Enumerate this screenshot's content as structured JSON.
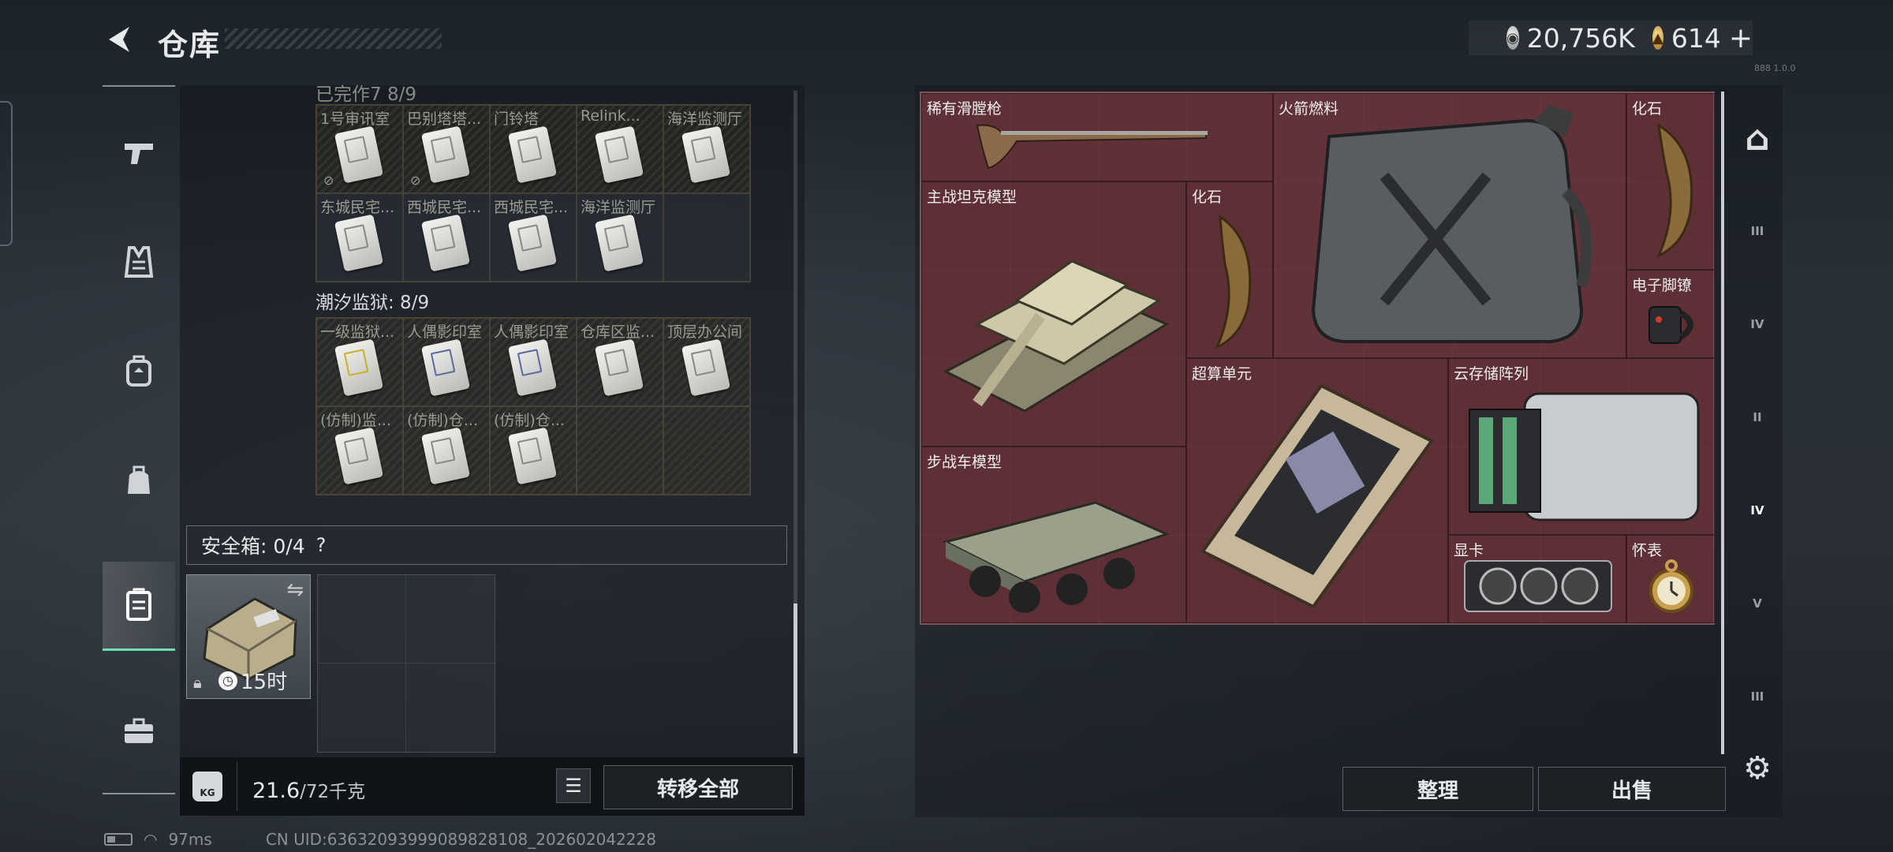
{
  "header": {
    "title": "仓库",
    "currency_silver": "20,756K",
    "currency_gold": "614",
    "currency_add": "+",
    "version_small": "888 1.0.0"
  },
  "left_nav": {
    "items": [
      {
        "name": "weapons",
        "icon": "pistol-icon"
      },
      {
        "name": "armor",
        "icon": "vest-icon"
      },
      {
        "name": "backpack",
        "icon": "backpack-icon"
      },
      {
        "name": "bag",
        "icon": "bag-icon"
      },
      {
        "name": "container",
        "icon": "container-icon",
        "active": true
      },
      {
        "name": "toolbox",
        "icon": "toolbox-icon"
      }
    ]
  },
  "keycards": {
    "section1_title": "已完作7 8/9",
    "grid1": [
      [
        "1号审讯室",
        "巴别塔塔...",
        "门铃塔",
        "Relink...",
        "海洋监测厅"
      ],
      [
        "东城民宅...",
        "西城民宅...",
        "西城民宅...",
        "海洋监测厅",
        ""
      ]
    ],
    "section2_title": "潮汐监狱: 8/9",
    "grid2": [
      [
        "一级监狱...",
        "人偶影印室",
        "人偶影印室",
        "仓库区监...",
        "顶层办公间"
      ],
      [
        "(仿制)监...",
        "(仿制)仓...",
        "(仿制)仓...",
        "",
        ""
      ]
    ]
  },
  "safebox": {
    "label": "安全箱: 0/4",
    "help": "?",
    "timer": "15时"
  },
  "weight": {
    "current": "21.6",
    "max_unit": "/72千克",
    "icon_label": "KG"
  },
  "buttons": {
    "transfer_all": "转移全部",
    "organize": "整理",
    "sell": "出售"
  },
  "items": [
    {
      "name": "稀有滑膛枪"
    },
    {
      "name": "火箭燃料"
    },
    {
      "name": "化石"
    },
    {
      "name": "主战坦克模型"
    },
    {
      "name": "化石"
    },
    {
      "name": "电子脚镣"
    },
    {
      "name": "超算单元"
    },
    {
      "name": "云存储阵列"
    },
    {
      "name": "步战车模型"
    },
    {
      "name": "显卡"
    },
    {
      "name": "怀表"
    }
  ],
  "right_nav": {
    "items": [
      {
        "label": "",
        "icon": "arch-icon"
      },
      {
        "label": "III",
        "icon": "tier3-armor-icon"
      },
      {
        "label": "IV",
        "icon": "tier4-folder-icon"
      },
      {
        "label": "II",
        "icon": "tier2-armor-icon"
      },
      {
        "label": "IV",
        "icon": "tier4-safe-icon",
        "active": true
      },
      {
        "label": "V",
        "icon": "tier5-safe-icon"
      },
      {
        "label": "III",
        "icon": "tier3-box-icon"
      }
    ]
  },
  "status": {
    "ping": "97ms",
    "uid": "CN UID:63632093999089828108_202602042228"
  },
  "colors": {
    "container_bg": "#5a2f34",
    "accent": "#6ee0b0"
  }
}
